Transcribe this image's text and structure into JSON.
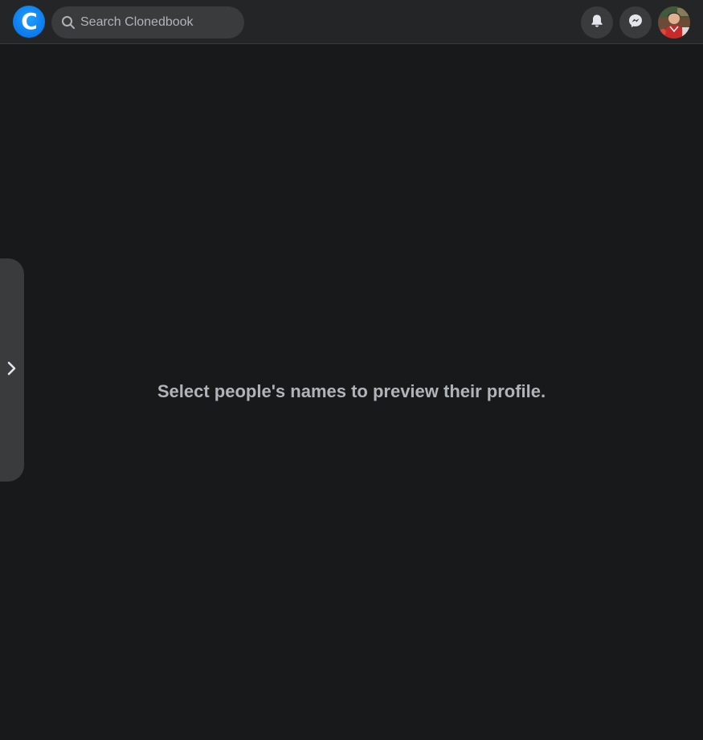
{
  "app": {
    "logo_letter": "C"
  },
  "search": {
    "placeholder": "Search Clonedbook",
    "value": ""
  },
  "header_icons": [
    "notifications-bell-icon",
    "messenger-icon"
  ],
  "colors": {
    "background": "#18191a",
    "topbar": "#242526",
    "button": "#3a3b3c",
    "brand_blue": "#0d7ff0",
    "text_secondary": "#b0b3b8"
  },
  "main": {
    "message": "Select people's names to preview their profile."
  },
  "sidebar_toggle": {
    "icon": "chevron-right-icon"
  }
}
